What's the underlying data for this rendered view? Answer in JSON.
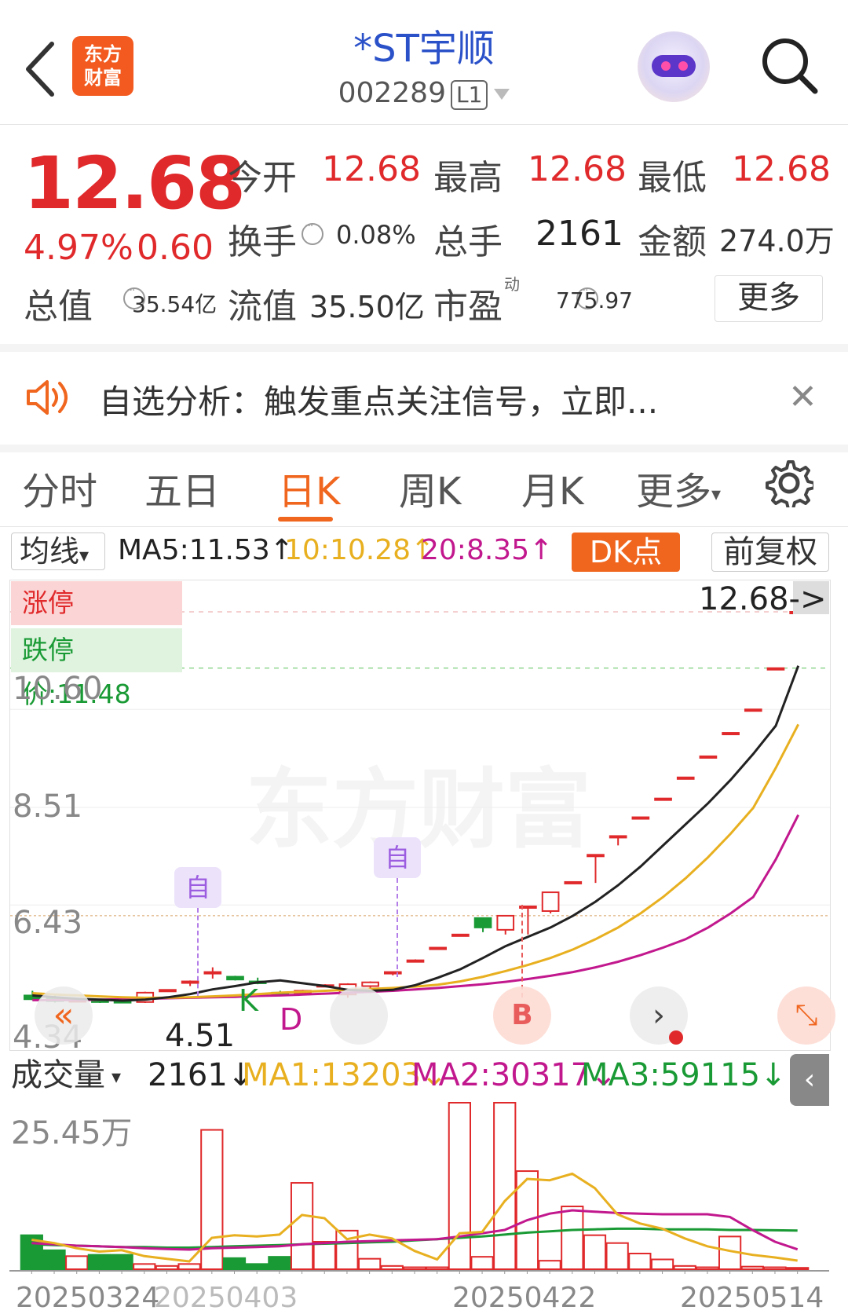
{
  "header": {
    "logo_text_1": "东方",
    "logo_text_2": "财富",
    "stock_name": "*ST宇顺",
    "stock_code": "002289",
    "level": "L1"
  },
  "quote": {
    "price": "12.68",
    "change_pct": "4.97%",
    "change": "0.60",
    "open_label": "今开",
    "open_value": "12.68",
    "high_label": "最高",
    "high_value": "12.68",
    "low_label": "最低",
    "low_value": "12.68",
    "turnover_label": "换手",
    "turnover_value": "0.08%",
    "volume_label": "总手",
    "volume_value": "2161",
    "amount_label": "金额",
    "amount_value": "274.0万",
    "mktcap_label": "总值",
    "mktcap_value": "35.54亿",
    "float_label": "流值",
    "float_value": "35.50亿",
    "pe_label": "市盈",
    "pe_sup": "动",
    "pe_value": "775.97",
    "more_label": "更多"
  },
  "alert": {
    "text": "自选分析：触发重点关注信号，立即..."
  },
  "tabs": [
    "分时",
    "五日",
    "日K",
    "周K",
    "月K",
    "更多"
  ],
  "active_tab": "日K",
  "indicators": {
    "ma_select": "均线",
    "ma5": "MA5:11.53↑",
    "ma10": "10:10.28↑",
    "ma20": "20:8.35↑",
    "dk_label": "DK点",
    "adjust_label": "前复权",
    "colors": {
      "ma5": "#222222",
      "ma10": "#e8b020",
      "ma20": "#c2188e",
      "up": "#e0292b",
      "down": "#1a9a35",
      "accent": "#f0661f"
    }
  },
  "kline": {
    "up_limit": "涨停价:12.68",
    "down_limit": "跌停价:11.48",
    "y_labels": [
      "10.60",
      "8.51",
      "6.43",
      "4.34"
    ],
    "last_price": "12.68->",
    "low_marker": "4.51",
    "marker_zi": "自",
    "marker_k": "K",
    "marker_d": "D",
    "marker_b": "B"
  },
  "volume": {
    "select": "成交量",
    "current": "2161↓",
    "ma1": "MA1:13203↓",
    "ma2": "MA2:30317↓",
    "ma3": "MA3:59115↓",
    "max_label": "25.45万",
    "colors": {
      "ma1": "#e8b020",
      "ma2": "#c2188e",
      "ma3": "#1a9a35"
    }
  },
  "dates": [
    "20250324",
    "20250403",
    "20250422",
    "20250514"
  ],
  "chart_data": {
    "type": "candlestick",
    "y_range": [
      4.34,
      12.68
    ],
    "candles": [
      {
        "o": 4.5,
        "h": 4.6,
        "l": 4.4,
        "c": 4.42
      },
      {
        "o": 4.45,
        "h": 4.5,
        "l": 4.35,
        "c": 4.38
      },
      {
        "o": 4.4,
        "h": 4.45,
        "l": 4.36,
        "c": 4.4
      },
      {
        "o": 4.4,
        "h": 4.42,
        "l": 4.34,
        "c": 4.36
      },
      {
        "o": 4.38,
        "h": 4.4,
        "l": 4.34,
        "c": 4.35
      },
      {
        "o": 4.36,
        "h": 4.58,
        "l": 4.34,
        "c": 4.56
      },
      {
        "o": 4.6,
        "h": 4.62,
        "l": 4.6,
        "c": 4.62
      },
      {
        "o": 4.8,
        "h": 4.82,
        "l": 4.7,
        "c": 4.8
      },
      {
        "o": 5.0,
        "h": 5.1,
        "l": 4.86,
        "c": 5.0
      },
      {
        "o": 4.9,
        "h": 4.92,
        "l": 4.82,
        "c": 4.84
      },
      {
        "o": 4.8,
        "h": 4.88,
        "l": 4.74,
        "c": 4.76
      },
      {
        "o": 4.56,
        "h": 4.6,
        "l": 4.5,
        "c": 4.52
      },
      {
        "o": 4.55,
        "h": 4.62,
        "l": 4.52,
        "c": 4.6
      },
      {
        "o": 4.7,
        "h": 4.74,
        "l": 4.68,
        "c": 4.72
      },
      {
        "o": 4.52,
        "h": 4.76,
        "l": 4.45,
        "c": 4.74
      },
      {
        "o": 4.7,
        "h": 4.8,
        "l": 4.55,
        "c": 4.78
      },
      {
        "o": 4.98,
        "h": 5.0,
        "l": 4.93,
        "c": 5.0
      },
      {
        "o": 5.25,
        "h": 5.27,
        "l": 5.25,
        "c": 5.25
      },
      {
        "o": 5.52,
        "h": 5.52,
        "l": 5.52,
        "c": 5.52
      },
      {
        "o": 5.8,
        "h": 5.8,
        "l": 5.8,
        "c": 5.8
      },
      {
        "o": 6.15,
        "h": 6.15,
        "l": 5.85,
        "c": 5.95
      },
      {
        "o": 5.9,
        "h": 6.2,
        "l": 5.8,
        "c": 6.2
      },
      {
        "o": 6.4,
        "h": 6.4,
        "l": 5.8,
        "c": 6.4
      },
      {
        "o": 6.3,
        "h": 6.7,
        "l": 6.25,
        "c": 6.7
      },
      {
        "o": 6.92,
        "h": 6.92,
        "l": 6.92,
        "c": 6.92
      },
      {
        "o": 7.5,
        "h": 7.5,
        "l": 6.9,
        "c": 7.5
      },
      {
        "o": 7.9,
        "h": 7.9,
        "l": 7.7,
        "c": 7.9
      },
      {
        "o": 8.3,
        "h": 8.3,
        "l": 8.3,
        "c": 8.3
      },
      {
        "o": 8.7,
        "h": 8.7,
        "l": 8.7,
        "c": 8.7
      },
      {
        "o": 9.15,
        "h": 9.15,
        "l": 9.15,
        "c": 9.15
      },
      {
        "o": 9.6,
        "h": 9.6,
        "l": 9.6,
        "c": 9.6
      },
      {
        "o": 10.1,
        "h": 10.1,
        "l": 10.1,
        "c": 10.1
      },
      {
        "o": 10.6,
        "h": 10.6,
        "l": 10.6,
        "c": 10.6
      },
      {
        "o": 11.48,
        "h": 11.48,
        "l": 11.48,
        "c": 11.48
      },
      {
        "o": 12.68,
        "h": 12.68,
        "l": 12.68,
        "c": 12.68
      }
    ],
    "ma5": [
      4.5,
      4.46,
      4.43,
      4.41,
      4.39,
      4.41,
      4.46,
      4.53,
      4.63,
      4.7,
      4.78,
      4.82,
      4.76,
      4.7,
      4.62,
      4.6,
      4.62,
      4.72,
      4.88,
      5.06,
      5.3,
      5.55,
      5.75,
      5.95,
      6.2,
      6.5,
      6.85,
      7.25,
      7.7,
      8.15,
      8.6,
      9.1,
      9.65,
      10.25,
      11.53
    ],
    "ma10": [
      4.55,
      4.52,
      4.5,
      4.48,
      4.46,
      4.45,
      4.45,
      4.46,
      4.48,
      4.5,
      4.53,
      4.56,
      4.58,
      4.6,
      4.62,
      4.64,
      4.66,
      4.69,
      4.73,
      4.8,
      4.9,
      5.02,
      5.15,
      5.3,
      5.48,
      5.7,
      5.95,
      6.25,
      6.6,
      7.0,
      7.45,
      7.95,
      8.5,
      9.35,
      10.28
    ],
    "ma20": [
      4.4,
      4.4,
      4.4,
      4.41,
      4.42,
      4.43,
      4.44,
      4.45,
      4.46,
      4.47,
      4.49,
      4.5,
      4.52,
      4.54,
      4.56,
      4.58,
      4.6,
      4.63,
      4.66,
      4.7,
      4.74,
      4.79,
      4.85,
      4.92,
      5.0,
      5.1,
      5.22,
      5.36,
      5.52,
      5.7,
      5.95,
      6.25,
      6.6,
      7.4,
      8.35
    ],
    "volume_max": 254500,
    "volumes": [
      {
        "v": 52000,
        "up": false
      },
      {
        "v": 29000,
        "up": false
      },
      {
        "v": 20000,
        "up": true
      },
      {
        "v": 22000,
        "up": false
      },
      {
        "v": 22000,
        "up": false
      },
      {
        "v": 8000,
        "up": true
      },
      {
        "v": 5000,
        "up": true
      },
      {
        "v": 8000,
        "up": true
      },
      {
        "v": 213000,
        "up": true
      },
      {
        "v": 17000,
        "up": false
      },
      {
        "v": 8000,
        "up": false
      },
      {
        "v": 19000,
        "up": false
      },
      {
        "v": 132000,
        "up": true
      },
      {
        "v": 42000,
        "up": true
      },
      {
        "v": 59000,
        "up": true
      },
      {
        "v": 16000,
        "up": true
      },
      {
        "v": 5000,
        "up": true
      },
      {
        "v": 3000,
        "up": true
      },
      {
        "v": 3000,
        "up": true
      },
      {
        "v": 254500,
        "up": true
      },
      {
        "v": 19000,
        "up": true
      },
      {
        "v": 254500,
        "up": true
      },
      {
        "v": 150000,
        "up": true
      },
      {
        "v": 13000,
        "up": true
      },
      {
        "v": 96000,
        "up": true
      },
      {
        "v": 52000,
        "up": true
      },
      {
        "v": 40000,
        "up": true
      },
      {
        "v": 24000,
        "up": true
      },
      {
        "v": 15000,
        "up": true
      },
      {
        "v": 5000,
        "up": true
      },
      {
        "v": 3000,
        "up": true
      },
      {
        "v": 50000,
        "up": true
      },
      {
        "v": 4000,
        "up": true
      },
      {
        "v": 3000,
        "up": true
      },
      {
        "v": 2161,
        "up": true
      }
    ],
    "vol_ma1": [
      45000,
      40000,
      32000,
      27000,
      29000,
      20000,
      16000,
      12000,
      48000,
      52000,
      50000,
      53000,
      83000,
      78000,
      46000,
      53000,
      47000,
      28000,
      15000,
      55000,
      57000,
      104000,
      138000,
      136000,
      146000,
      124000,
      84000,
      70000,
      62000,
      47000,
      35000,
      28000,
      22000,
      18000,
      13203
    ],
    "vol_ma2": [
      40000,
      38000,
      36000,
      35000,
      34000,
      32000,
      31000,
      30000,
      32000,
      33000,
      34000,
      35000,
      38000,
      40000,
      42000,
      43000,
      44000,
      45000,
      46000,
      50000,
      55000,
      60000,
      75000,
      85000,
      90000,
      88000,
      86000,
      85000,
      84000,
      84000,
      84000,
      80000,
      60000,
      42000,
      30317
    ],
    "vol_ma3": [
      38000,
      37000,
      36000,
      35000,
      34000,
      34000,
      33000,
      33000,
      34000,
      35000,
      36000,
      37000,
      38000,
      39000,
      40000,
      41000,
      42000,
      44000,
      46000,
      48000,
      50000,
      53000,
      56000,
      58000,
      60000,
      61000,
      62000,
      62000,
      61000,
      61000,
      61000,
      60000,
      60000,
      59500,
      59115
    ]
  }
}
